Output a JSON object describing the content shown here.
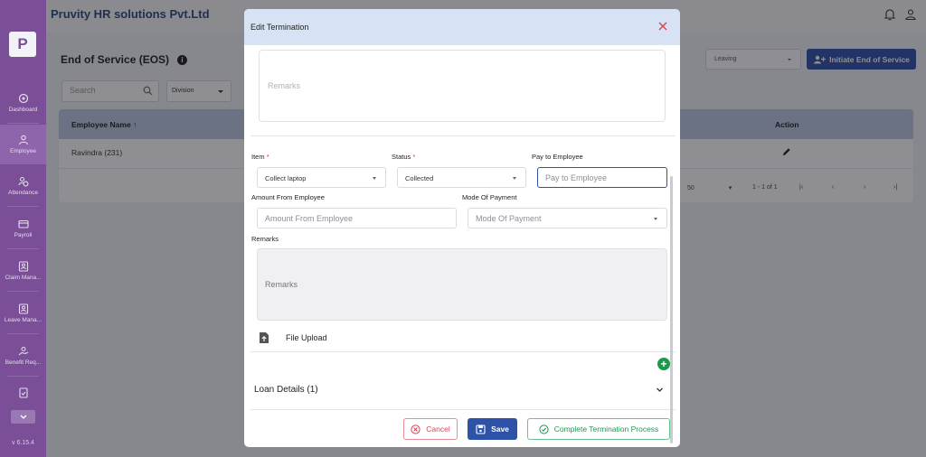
{
  "app": {
    "company": "Pruvity HR solutions Pvt.Ltd",
    "logo_letter": "P",
    "version": "v 6.15.4"
  },
  "sidebar": {
    "items": [
      {
        "label": "Dashboard",
        "icon": "dashboard-icon"
      },
      {
        "label": "Employee",
        "icon": "person-icon",
        "active": true
      },
      {
        "label": "Attendance",
        "icon": "attendance-icon"
      },
      {
        "label": "Payroll",
        "icon": "wallet-icon"
      },
      {
        "label": "Claim Mana...",
        "icon": "claim-icon"
      },
      {
        "label": "Leave Mana...",
        "icon": "leave-icon"
      },
      {
        "label": "Benefit Req...",
        "icon": "benefit-icon"
      },
      {
        "label": "",
        "icon": "document-icon"
      }
    ]
  },
  "page": {
    "title": "End of Service (EOS)",
    "search_placeholder": "Search",
    "division_label": "Division",
    "leaving_select": "Leaving",
    "initiate_button": "Initiate End of Service",
    "table": {
      "col_employee": "Employee Name",
      "col_action": "Action",
      "rows": [
        {
          "employee": "Ravindra  (231)"
        }
      ]
    },
    "pager": {
      "rows_per_page": "50",
      "range": "1 - 1 of 1"
    }
  },
  "modal": {
    "title": "Edit Termination",
    "remarks_top_placeholder": "Remarks",
    "fields": {
      "item_label": "Item",
      "item_value": "Collect laptop",
      "status_label": "Status",
      "status_value": "Collected",
      "pay_label": "Pay to Employee",
      "pay_placeholder": "Pay to Employee",
      "amount_label": "Amount From Employee",
      "amount_placeholder": "Amount From Employee",
      "mode_label": "Mode Of Payment",
      "mode_placeholder": "Mode Of Payment",
      "remarks_label": "Remarks",
      "remarks_placeholder": "Remarks",
      "required_mark": "*"
    },
    "file_upload": "File Upload",
    "loan_details": "Loan Details (1)",
    "buttons": {
      "cancel": "Cancel",
      "save": "Save",
      "complete": "Complete Termination Process"
    }
  },
  "colors": {
    "sidebar": "#7a4f98",
    "primary": "#2d52a7",
    "success": "#1a9a4b",
    "danger": "#d9444d",
    "modal_header": "#d7e3f4"
  }
}
